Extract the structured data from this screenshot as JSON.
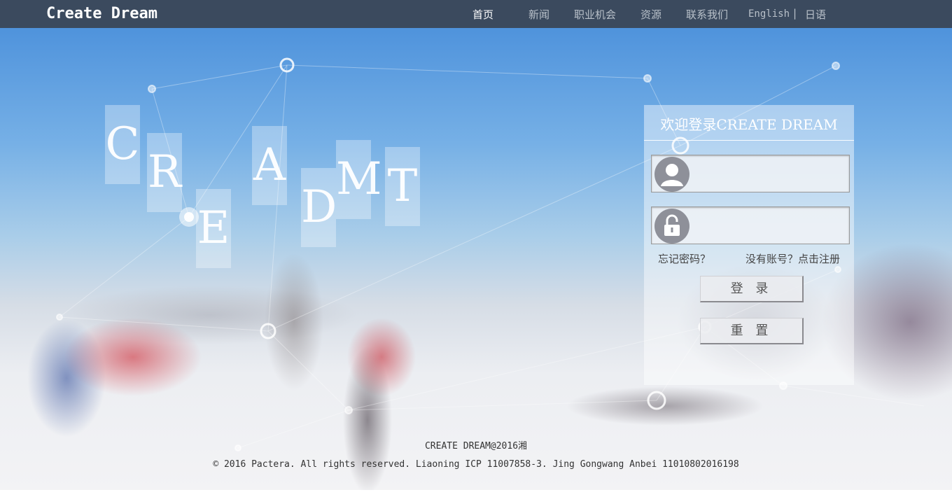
{
  "header": {
    "brand": "Create Dream",
    "nav": [
      "首页",
      "新闻",
      "职业机会",
      "资源",
      "联系我们"
    ],
    "lang_english": "English",
    "lang_sep": "|",
    "lang_japanese": "日语"
  },
  "hero": {
    "letters": [
      "C",
      "R",
      "E",
      "A",
      "D",
      "M",
      "T"
    ]
  },
  "login": {
    "title": "欢迎登录CREATE DREAM",
    "username_value": "",
    "password_value": "",
    "forgot_password": "忘记密码？",
    "register": "没有账号？点击注册",
    "login_button": "登 录",
    "reset_button": "重 置"
  },
  "footer": {
    "line1": "CREATE DREAM@2016湘",
    "line2": "© 2016 Pactera. All rights reserved. Liaoning ICP 11007858-3. Jing Gongwang Anbei 11010802016198"
  },
  "colors": {
    "topbar": "#3b4a5e",
    "icon_circle": "#8e9099"
  }
}
